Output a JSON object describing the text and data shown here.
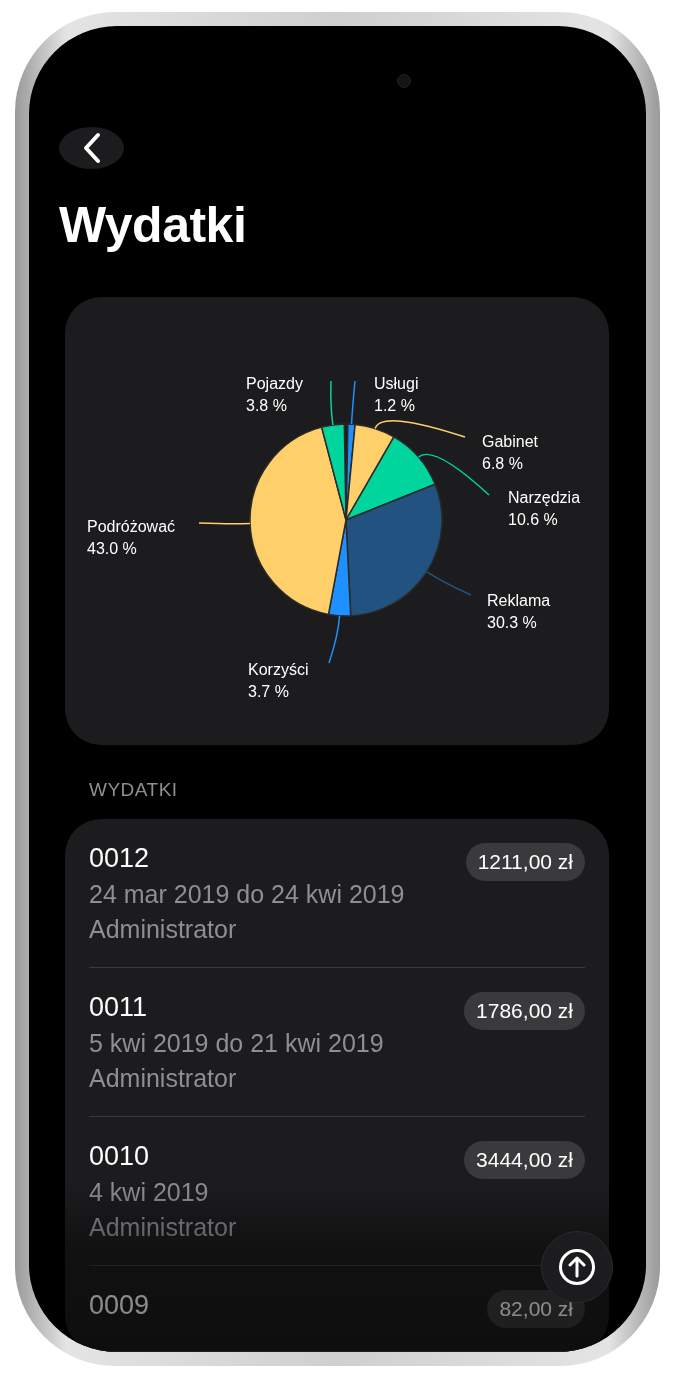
{
  "title": "Wydatki",
  "chart": {
    "chart_data": {
      "type": "pie",
      "categories": [
        "Usługi",
        "Gabinet",
        "Narzędzia",
        "Reklama",
        "Korzyści",
        "Podróżować",
        "Pojazdy"
      ],
      "values": [
        1.2,
        6.8,
        10.6,
        30.3,
        3.7,
        43.0,
        3.8
      ],
      "value_labels": [
        "1.2 %",
        "6.8 %",
        "10.6 %",
        "30.3 %",
        "3.7 %",
        "43.0 %",
        "3.8 %"
      ]
    }
  },
  "section_header": "WYDATKI",
  "expenses": [
    {
      "number": "0012",
      "period": "24 mar 2019 do 24 kwi 2019",
      "owner": "Administrator",
      "amount": "1211,00 zł"
    },
    {
      "number": "0011",
      "period": "5 kwi 2019 do 21 kwi 2019",
      "owner": "Administrator",
      "amount": "1786,00 zł"
    },
    {
      "number": "0010",
      "period": "4 kwi 2019",
      "owner": "Administrator",
      "amount": "3444,00 zł"
    },
    {
      "number": "0009",
      "amount": "82,00 zł"
    }
  ]
}
